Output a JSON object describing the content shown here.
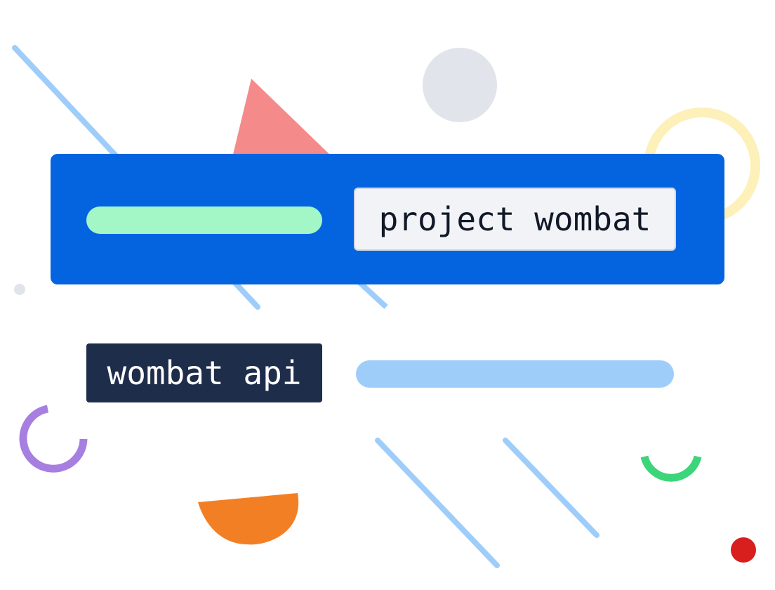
{
  "chips": {
    "project_label": "project wombat",
    "api_label": "wombat api"
  },
  "colors": {
    "card_blue": "#0464e0",
    "line_blue": "#9fcdfa",
    "pill_green": "#a3f6c6",
    "chip_light": "#f2f3f6",
    "chip_dark": "#1e2d4a",
    "triangle_coral": "#f48a8a",
    "circle_gray": "#e1e4eb",
    "ring_yellow": "#fdf0b8",
    "arc_purple": "#a67fe0",
    "arc_green": "#3dd57a",
    "semicircle_orange": "#f37f24",
    "dot_red": "#d91e1e"
  },
  "decorations": {
    "shapes": [
      "diagonal-line",
      "triangle",
      "circle",
      "ring",
      "arc",
      "semicircle",
      "dot"
    ]
  }
}
